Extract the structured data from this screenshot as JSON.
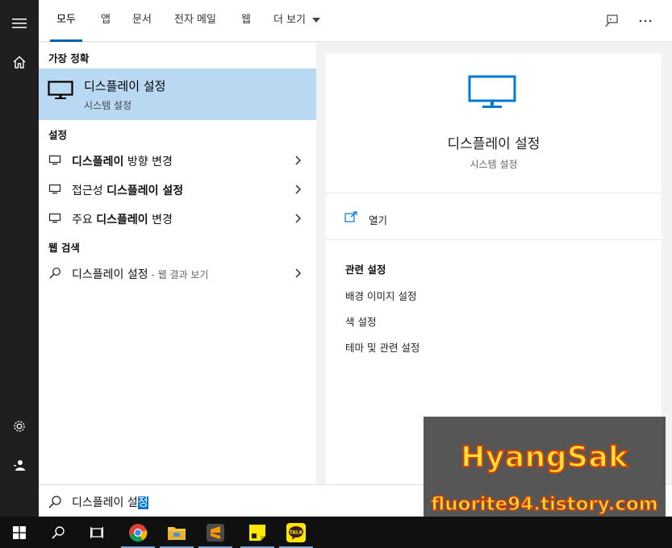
{
  "tabs": [
    {
      "label": "모두",
      "active": true
    },
    {
      "label": "앱"
    },
    {
      "label": "문서"
    },
    {
      "label": "전자 메일"
    },
    {
      "label": "웹"
    },
    {
      "label": "더 보기"
    }
  ],
  "sections": {
    "best_match": "가장 정확",
    "settings": "설정",
    "web_search": "웹 검색"
  },
  "best": {
    "title": "디스플레이 설정",
    "subtitle": "시스템 설정"
  },
  "settings_items": [
    {
      "bold": "디스플레이",
      "rest": " 방향 변경"
    },
    {
      "pre": "접근성 ",
      "bold": "디스플레이 설정"
    },
    {
      "pre": "주요 ",
      "bold": "디스플레이",
      "rest": " 변경"
    }
  ],
  "web_item": {
    "query": "디스플레이 설정",
    "suffix": " - 웹 결과 보기"
  },
  "preview": {
    "title": "디스플레이 설정",
    "subtitle": "시스템 설정",
    "open_label": "열기",
    "related_heading": "관련 설정",
    "related": [
      "배경 이미지 설정",
      "색 설정",
      "테마 및 관련 설정"
    ]
  },
  "search": {
    "typed": "디스플레이 설",
    "selected": "정"
  },
  "watermark": {
    "line1": "HyangSak",
    "line2": "fluorite94.tistory.com"
  },
  "colors": {
    "accent": "#0078d7",
    "highlight": "#b9d9f2",
    "tab_underline": "#0063b1"
  },
  "icons": {
    "rail": [
      "hamburger-icon",
      "home-icon",
      "gear-icon",
      "user-icon"
    ],
    "taskbar": [
      "windows-start-icon",
      "search-icon",
      "task-view-icon",
      "chrome-icon",
      "file-explorer-icon",
      "sublime-text-icon",
      "sticky-notes-icon",
      "kakaotalk-icon"
    ]
  }
}
